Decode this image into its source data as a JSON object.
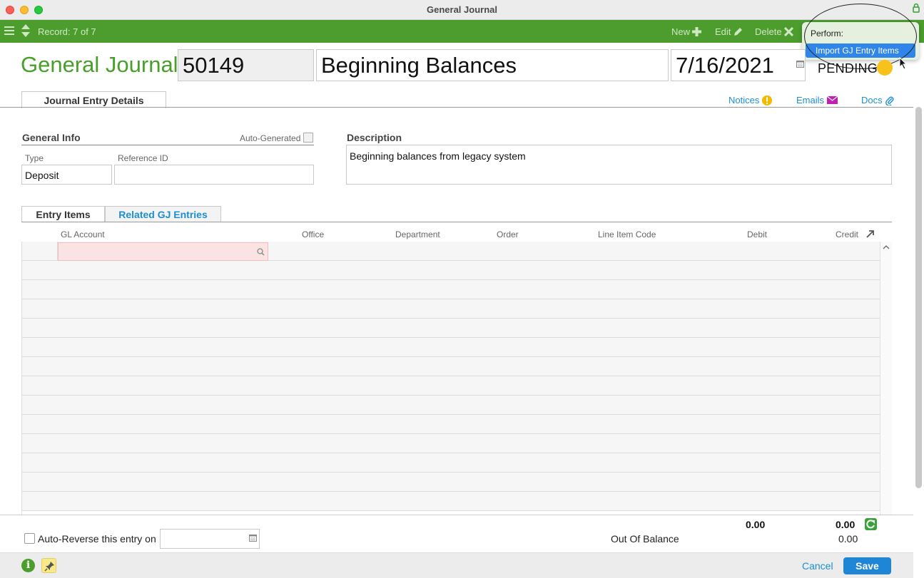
{
  "window": {
    "title": "General Journal"
  },
  "toolbar": {
    "record_label": "Record: 7 of 7",
    "new_label": "New",
    "edit_label": "Edit",
    "delete_label": "Delete",
    "accent_color": "#4c9c2e"
  },
  "perform_menu": {
    "label": "Perform:",
    "items": [
      {
        "label": "Import GJ Entry Items",
        "highlighted": true
      }
    ]
  },
  "header": {
    "title": "General Journal:",
    "number": "50149",
    "name": "Beginning Balances",
    "date": "7/16/2021",
    "status": "PENDING",
    "status_color": "#f7c21a"
  },
  "tabs": {
    "main": "Journal Entry Details",
    "links": {
      "notices": "Notices",
      "emails": "Emails",
      "docs": "Docs"
    }
  },
  "general_info": {
    "heading": "General Info",
    "auto_generated_label": "Auto-Generated",
    "auto_generated": false,
    "type_label": "Type",
    "type_value": "Deposit",
    "reference_label": "Reference ID",
    "reference_value": ""
  },
  "description": {
    "heading": "Description",
    "value": "Beginning balances from legacy system"
  },
  "subtabs": {
    "entry_items": "Entry Items",
    "related": "Related GJ Entries"
  },
  "grid": {
    "columns": [
      "GL Account",
      "Office",
      "Department",
      "Order",
      "Line Item Code",
      "Debit",
      "Credit"
    ],
    "row_count": 14
  },
  "totals": {
    "debit": "0.00",
    "credit": "0.00",
    "out_of_balance_label": "Out Of Balance",
    "out_of_balance_value": "0.00"
  },
  "auto_reverse": {
    "label": "Auto-Reverse this entry on",
    "checked": false,
    "date": ""
  },
  "footer": {
    "cancel_label": "Cancel",
    "save_label": "Save"
  }
}
